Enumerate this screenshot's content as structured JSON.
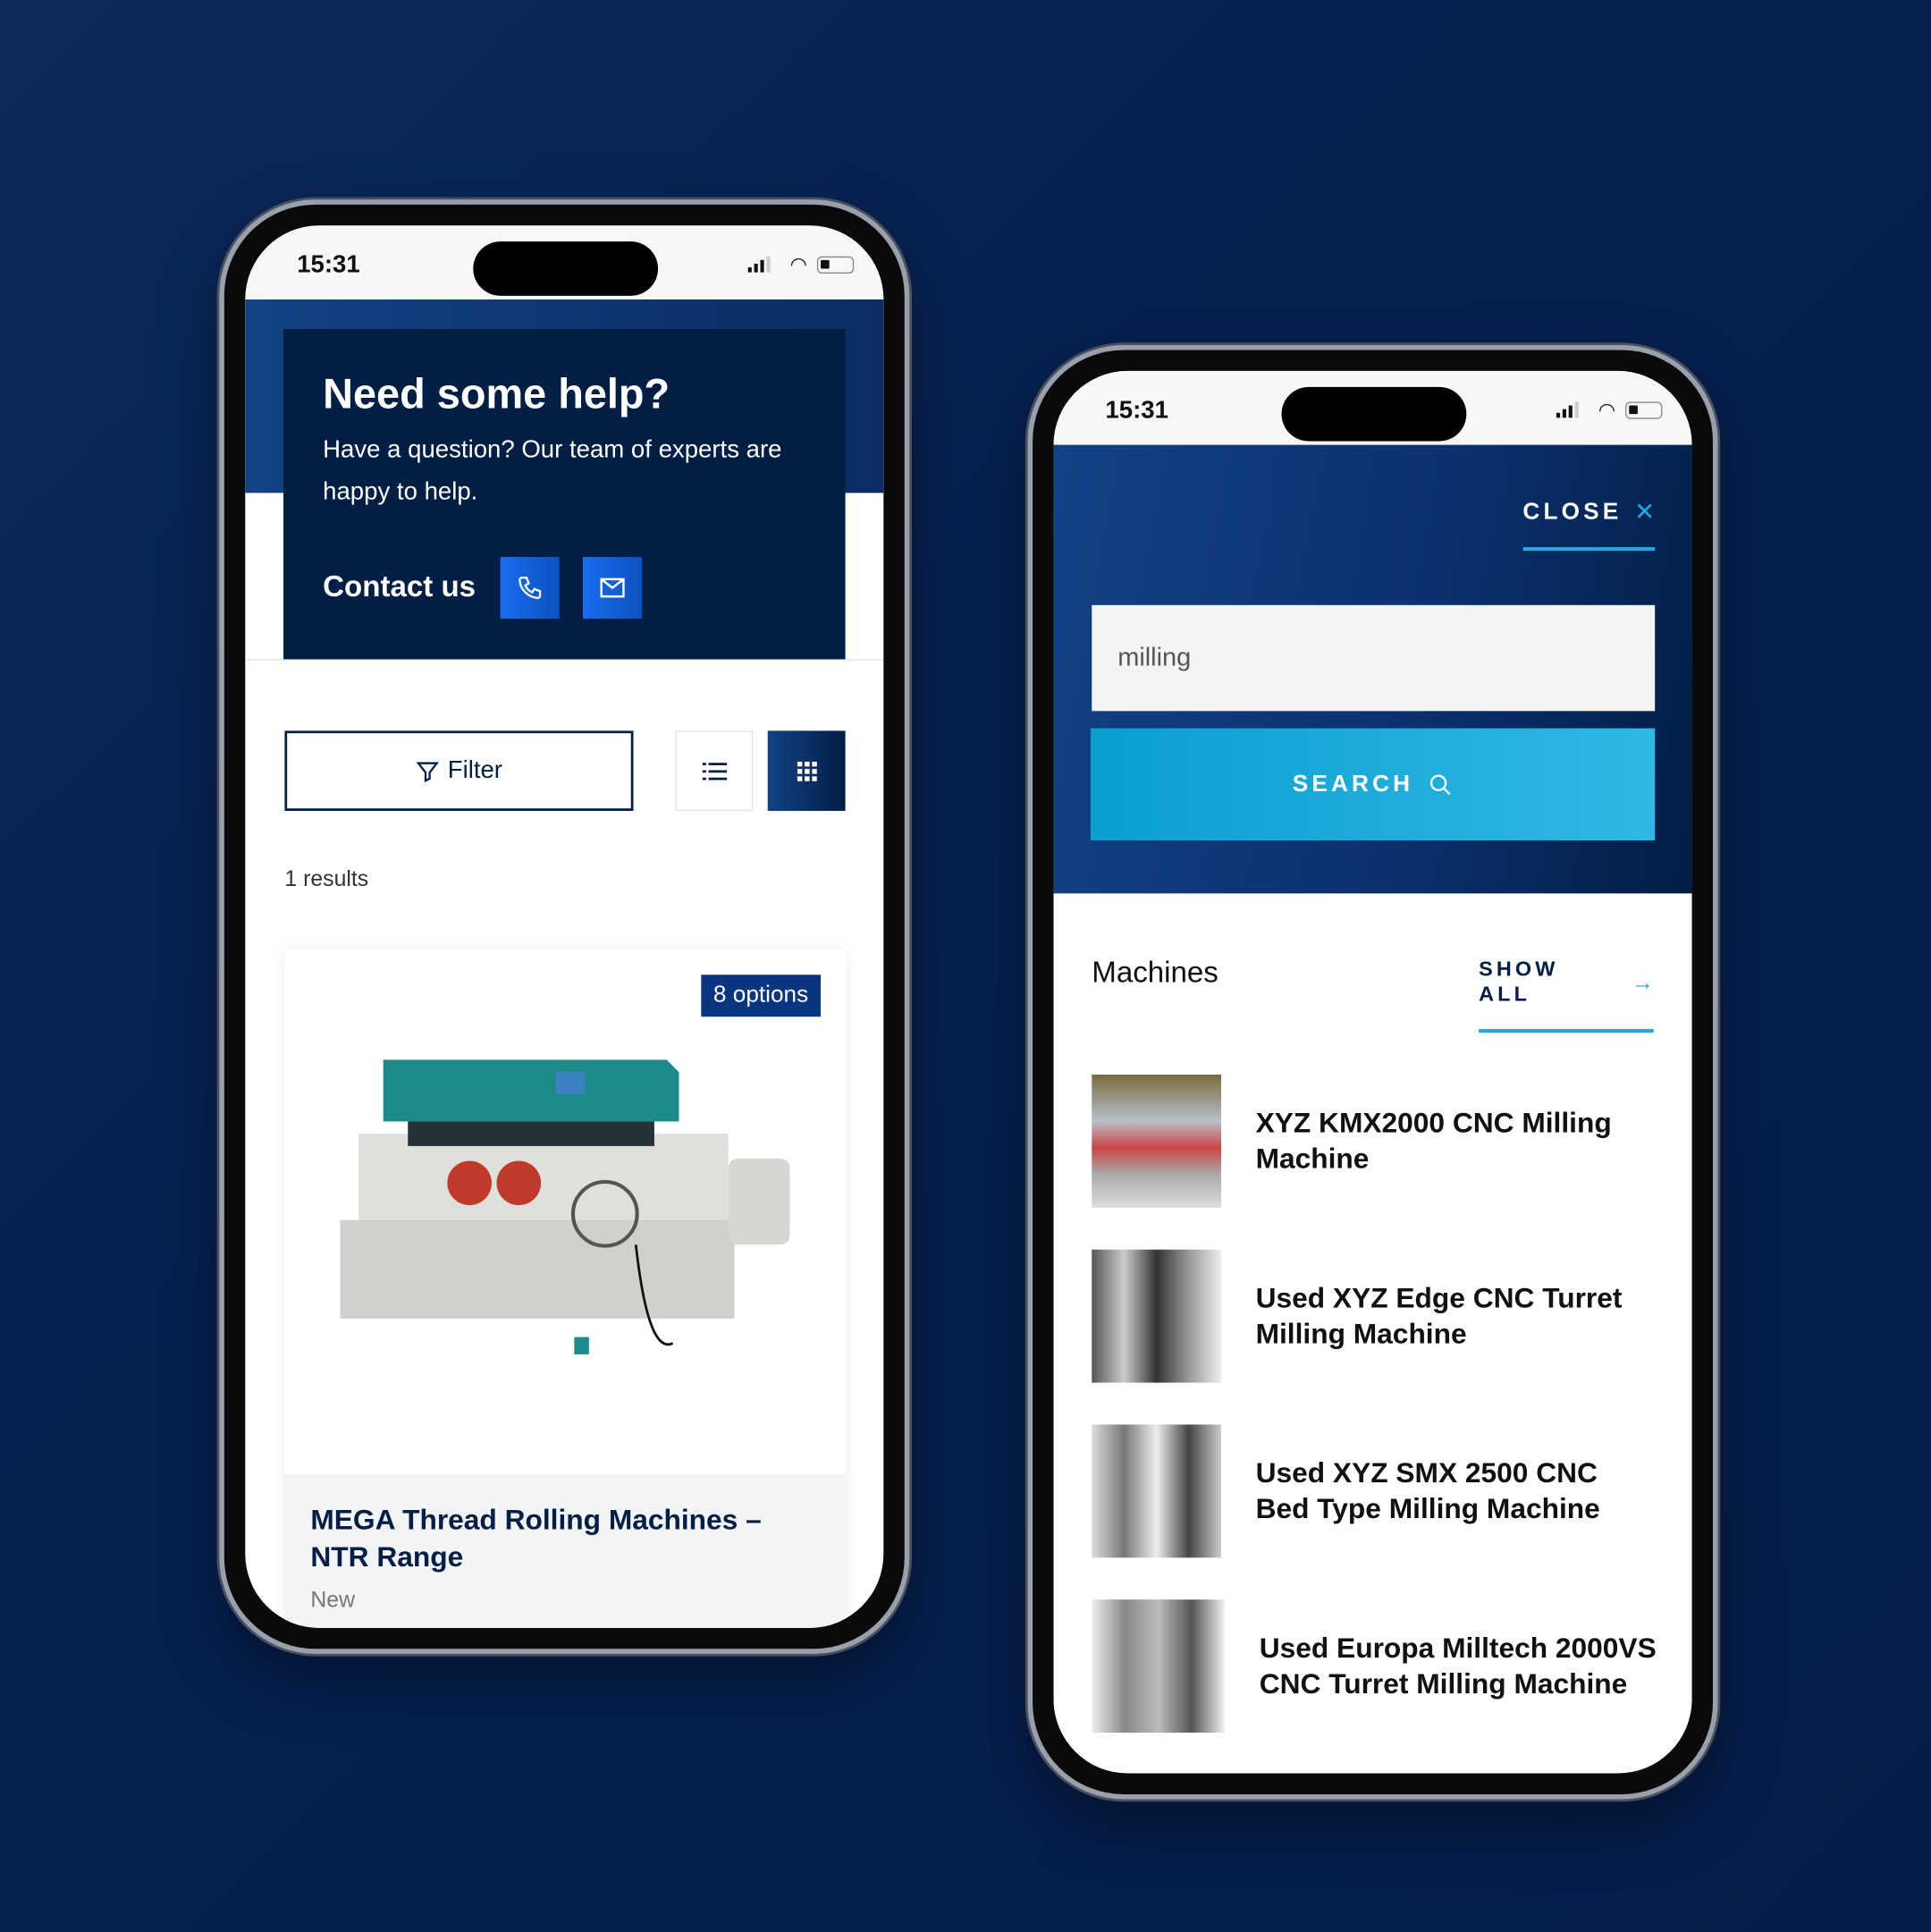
{
  "left_phone": {
    "status": {
      "time": "15:31"
    },
    "help": {
      "title": "Need some help?",
      "text": "Have a question? Our team of experts are happy to help.",
      "contact_label": "Contact us",
      "phone_icon": "phone-icon",
      "email_icon": "mail-icon"
    },
    "toolbar": {
      "filter_label": "Filter",
      "list_view": "list-icon",
      "grid_view": "grid-icon"
    },
    "results_count": "1 results",
    "product": {
      "badge": "8 options",
      "title": "MEGA Thread Rolling Machines – NTR Range",
      "condition": "New"
    }
  },
  "right_phone": {
    "status": {
      "time": "15:31"
    },
    "close_label": "CLOSE",
    "search": {
      "value": "milling",
      "button_label": "SEARCH"
    },
    "section": {
      "title": "Machines",
      "show_all": "SHOW ALL"
    },
    "results": [
      {
        "title": "XYZ KMX2000 CNC Milling Machine"
      },
      {
        "title": "Used XYZ Edge CNC Turret Milling Machine"
      },
      {
        "title": "Used XYZ SMX 2500 CNC Bed Type Milling Machine"
      },
      {
        "title": "Used Europa Milltech 2000VS CNC Turret Milling Machine"
      }
    ]
  },
  "colors": {
    "navy": "#011e45",
    "brand_blue": "#1565d8",
    "cyan": "#1ea8d8",
    "background": "#062050"
  }
}
